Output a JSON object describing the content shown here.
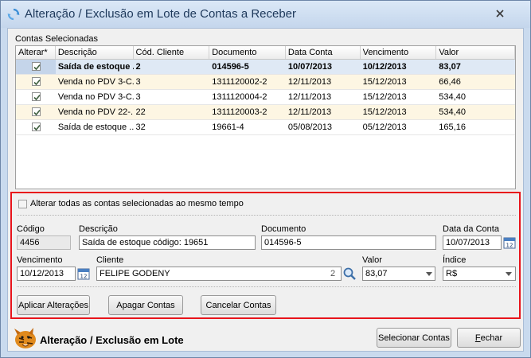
{
  "window": {
    "title": "Alteração / Exclusão em Lote de Contas a Receber",
    "close_glyph": "✕"
  },
  "grid": {
    "section_label": "Contas Selecionadas",
    "columns": [
      "Alterar*",
      "Descrição",
      "Cód. Cliente",
      "Documento",
      "Data Conta",
      "Vencimento",
      "Valor"
    ],
    "rows": [
      {
        "checked": true,
        "descricao": "Saída de estoque ...",
        "cod_cliente": "2",
        "documento": "014596-5",
        "data_conta": "10/07/2013",
        "vencimento": "10/12/2013",
        "valor": "83,07"
      },
      {
        "checked": true,
        "descricao": "Venda no PDV 3-C...",
        "cod_cliente": "3",
        "documento": "1311120002-2",
        "data_conta": "12/11/2013",
        "vencimento": "15/12/2013",
        "valor": "66,46"
      },
      {
        "checked": true,
        "descricao": "Venda no PDV 3-C...",
        "cod_cliente": "3",
        "documento": "1311120004-2",
        "data_conta": "12/11/2013",
        "vencimento": "15/12/2013",
        "valor": "534,40"
      },
      {
        "checked": true,
        "descricao": "Venda no PDV 22-...",
        "cod_cliente": "22",
        "documento": "1311120003-2",
        "data_conta": "12/11/2013",
        "vencimento": "15/12/2013",
        "valor": "534,40"
      },
      {
        "checked": true,
        "descricao": "Saída de estoque ...",
        "cod_cliente": "32",
        "documento": "19661-4",
        "data_conta": "05/08/2013",
        "vencimento": "05/12/2013",
        "valor": "165,16"
      }
    ]
  },
  "form": {
    "alter_all_label": "Alterar todas as contas selecionadas ao mesmo tempo",
    "codigo_label": "Código",
    "codigo_value": "4456",
    "descricao_label": "Descrição",
    "descricao_value": "Saída de estoque código: 19651",
    "documento_label": "Documento",
    "documento_value": "014596-5",
    "data_conta_label": "Data da Conta",
    "data_conta_value": "10/07/2013",
    "vencimento_label": "Vencimento",
    "vencimento_value": "10/12/2013",
    "cliente_label": "Cliente",
    "cliente_value": "FELIPE GODENY",
    "cliente_code": "2",
    "valor_label": "Valor",
    "valor_value": "83,07",
    "indice_label": "Índice",
    "indice_value": "R$",
    "calendar_day": "12"
  },
  "actions": {
    "apply": "Aplicar Alterações",
    "delete": "Apagar Contas",
    "cancel": "Cancelar Contas"
  },
  "footer": {
    "title": "Alteração / Exclusão em Lote",
    "select_accounts": "Selecionar Contas",
    "close_prefix": "F",
    "close_rest": "echar"
  },
  "colors": {
    "panel_border": "#e8141b",
    "title_text": "#1e395b",
    "selected_row": "#dfe9f5",
    "alt_row": "#fdf6e3"
  }
}
